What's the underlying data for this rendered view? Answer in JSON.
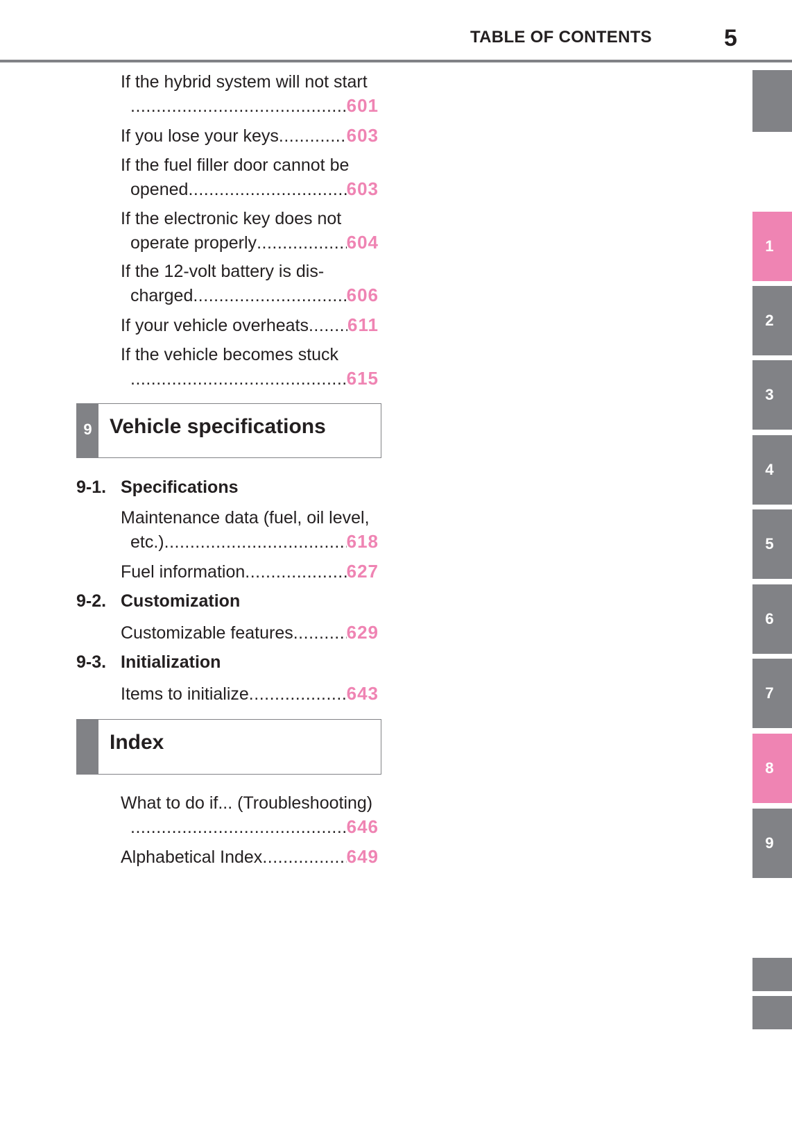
{
  "header": {
    "title": "TABLE OF CONTENTS",
    "page_number": "5"
  },
  "colors": {
    "accent_pink": "#ef84b3",
    "tab_gray": "#818286",
    "text": "#231f20"
  },
  "top_entries": [
    {
      "lines": [
        "If the hybrid system will not start"
      ],
      "last": "",
      "page": "601"
    },
    {
      "lines": [],
      "last": "If you lose your keys",
      "page": "603"
    },
    {
      "lines": [
        "If the fuel filler door cannot be"
      ],
      "last": "opened",
      "page": "603"
    },
    {
      "lines": [
        "If the electronic key does not"
      ],
      "last": "operate properly ",
      "page": "604"
    },
    {
      "lines": [
        "If the 12-volt battery is dis-"
      ],
      "last": "charged",
      "page": "606"
    },
    {
      "lines": [],
      "last": "If your vehicle overheats",
      "page": "611"
    },
    {
      "lines": [
        "If the vehicle becomes stuck"
      ],
      "last": "",
      "page": "615"
    }
  ],
  "section9": {
    "number": "9",
    "title": "Vehicle specifications",
    "subsections": [
      {
        "number": "9-1.",
        "title": "Specifications",
        "entries": [
          {
            "lines": [
              "Maintenance data (fuel, oil level,"
            ],
            "last": "etc.)",
            "page": "618"
          },
          {
            "lines": [],
            "last": "Fuel information ",
            "page": "627"
          }
        ]
      },
      {
        "number": "9-2.",
        "title": "Customization",
        "entries": [
          {
            "lines": [],
            "last": "Customizable features ",
            "page": "629"
          }
        ]
      },
      {
        "number": "9-3.",
        "title": "Initialization",
        "entries": [
          {
            "lines": [],
            "last": "Items to initialize ",
            "page": "643"
          }
        ]
      }
    ]
  },
  "index_section": {
    "title": "Index",
    "entries": [
      {
        "lines": [
          "What to do if... (Troubleshooting)"
        ],
        "last": "",
        "page": "646"
      },
      {
        "lines": [],
        "last": "Alphabetical Index  ",
        "page": "649"
      }
    ]
  },
  "side_tabs": [
    {
      "label": "1",
      "active": true
    },
    {
      "label": "2",
      "active": false
    },
    {
      "label": "3",
      "active": false
    },
    {
      "label": "4",
      "active": false
    },
    {
      "label": "5",
      "active": false
    },
    {
      "label": "6",
      "active": false
    },
    {
      "label": "7",
      "active": false
    },
    {
      "label": "8",
      "active": true
    },
    {
      "label": "9",
      "active": false
    }
  ]
}
